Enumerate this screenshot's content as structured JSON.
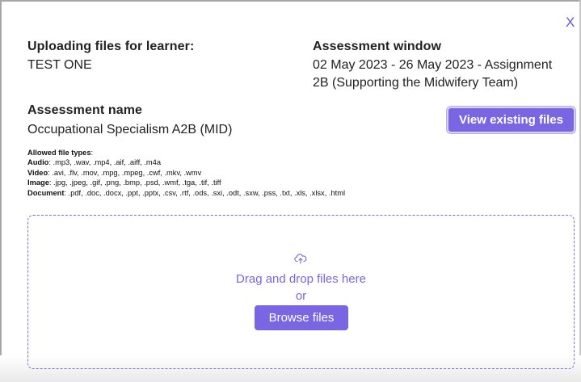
{
  "dialog": {
    "close_label": "X",
    "learner_label": "Uploading files for learner:",
    "learner_value": "TEST ONE",
    "window_label": "Assessment window",
    "window_value_line1": "02 May 2023 - 26 May 2023 - Assignment",
    "window_value_line2": "2B (Supporting the Midwifery Team)",
    "assessment_label": "Assessment name",
    "assessment_value": "Occupational Specialism A2B (MID)",
    "view_files_label": "View existing files"
  },
  "file_types": {
    "title": "Allowed file types",
    "audio_label": "Audio",
    "audio_value": ": .mp3, .wav, .mp4, .aif, .aiff, .m4a",
    "video_label": "Video",
    "video_value": ": .avi, .flv, .mov, .mpg, .mpeg, .cwf, .mkv, .wmv",
    "image_label": "Image",
    "image_value": ": .jpg, .jpeg, .gif, .png, .bmp, .psd, .wmf, .tga, .tif, .tiff",
    "document_label": "Document",
    "document_value": ": .pdf, .doc, .docx, .ppt, .pptx, .csv, .rtf, .ods, .sxi, .odt, .sxw, .pss, .txt, .xls, .xlsx, .html"
  },
  "dropzone": {
    "icon": "cloud-upload-icon",
    "drag_text": "Drag and drop files here",
    "or_text": "or",
    "browse_label": "Browse files"
  },
  "colors": {
    "accent": "#7a65e3",
    "text": "#222222"
  }
}
